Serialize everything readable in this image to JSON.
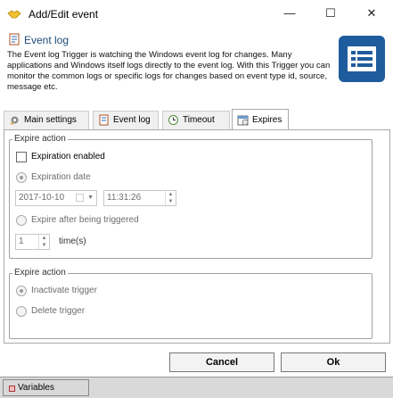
{
  "window": {
    "title": "Add/Edit event",
    "minimize": "—",
    "maximize": "☐",
    "close": "✕"
  },
  "header": {
    "title": "Event log",
    "description": "The Event log Trigger is watching the Windows event log for changes. Many applications and Windows itself logs directly to the event log. With this Trigger you can monitor the common logs or specific logs for changes based on event type id, source, message etc."
  },
  "tabs": [
    {
      "label": "Main settings",
      "icon": "gear-icon"
    },
    {
      "label": "Event log",
      "icon": "event-log-icon"
    },
    {
      "label": "Timeout",
      "icon": "clock-icon"
    },
    {
      "label": "Expires",
      "icon": "calendar-icon",
      "active": true
    }
  ],
  "expire_action_1": {
    "legend": "Expire action",
    "expiration_enabled": {
      "label": "Expiration enabled",
      "checked": false
    },
    "expiration_date": {
      "label": "Expiration date",
      "selected": true
    },
    "date_value": "2017-10-10",
    "time_value": "11:31:26",
    "expire_after_triggered": {
      "label": "Expire after being triggered",
      "selected": false
    },
    "times_value": "1",
    "times_label": "time(s)"
  },
  "expire_action_2": {
    "legend": "Expire action",
    "inactivate": {
      "label": "Inactivate trigger",
      "selected": true
    },
    "delete": {
      "label": "Delete trigger",
      "selected": false
    }
  },
  "buttons": {
    "cancel": "Cancel",
    "ok": "Ok"
  },
  "footer": {
    "variables": "Variables"
  },
  "colors": {
    "accent": "#1f5c9e",
    "header_title": "#1f4a7a"
  }
}
